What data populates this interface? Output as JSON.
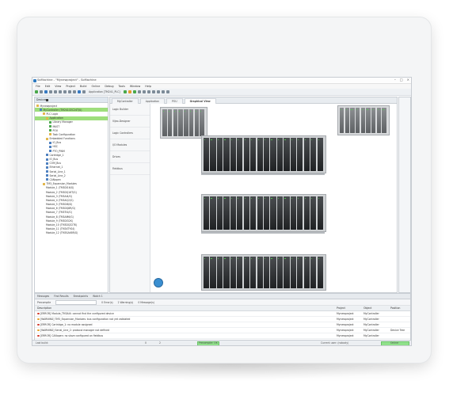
{
  "window": {
    "title": "SoMachine - \"Mynewproject\" - SoMachine"
  },
  "menu": [
    "File",
    "Edit",
    "View",
    "Project",
    "Build",
    "Online",
    "Debug",
    "Tools",
    "Window",
    "Help"
  ],
  "toolbar": {
    "application_selector": "Application [TM241_PLC]"
  },
  "left_panel": {
    "header": "Devices",
    "tree": [
      {
        "label": "Mynewproject",
        "icon": "folder",
        "indent": 0,
        "selected": false
      },
      {
        "label": "MyController (TM241CEC24T/U)",
        "icon": "dev",
        "indent": 1,
        "selected": true
      },
      {
        "label": "PLC Logic",
        "icon": "folder",
        "indent": 2,
        "selected": false
      },
      {
        "label": "Application",
        "icon": "folder",
        "indent": 3,
        "selected": true
      },
      {
        "label": "Library Manager",
        "icon": "green",
        "indent": 4,
        "selected": false
      },
      {
        "label": "MAST",
        "icon": "green",
        "indent": 4,
        "selected": false
      },
      {
        "label": "POU",
        "icon": "green",
        "indent": 4,
        "selected": false
      },
      {
        "label": "Task Configuration",
        "icon": "folder",
        "indent": 4,
        "selected": false
      },
      {
        "label": "Embedded Functions",
        "icon": "folder",
        "indent": 3,
        "selected": false
      },
      {
        "label": "IO_Bus",
        "icon": "dev",
        "indent": 4,
        "selected": false
      },
      {
        "label": "HSC",
        "icon": "dev",
        "indent": 4,
        "selected": false
      },
      {
        "label": "PTO_PWM",
        "icon": "dev",
        "indent": 4,
        "selected": false
      },
      {
        "label": "Cartridge_1",
        "icon": "dev",
        "indent": 3,
        "selected": false
      },
      {
        "label": "IO_Bus",
        "icon": "dev",
        "indent": 3,
        "selected": false
      },
      {
        "label": "COM_Bus",
        "icon": "dev",
        "indent": 3,
        "selected": false
      },
      {
        "label": "Ethernet_1",
        "icon": "dev",
        "indent": 3,
        "selected": false
      },
      {
        "label": "Serial_Line_1",
        "icon": "dev",
        "indent": 3,
        "selected": false
      },
      {
        "label": "Serial_Line_2",
        "icon": "dev",
        "indent": 3,
        "selected": false
      },
      {
        "label": "CANopen",
        "icon": "dev",
        "indent": 3,
        "selected": false
      },
      {
        "label": "TM3_Expansion_Modules",
        "icon": "folder",
        "indent": 2,
        "selected": false
      },
      {
        "label": "Module_1 (TM3DI16/G)",
        "icon": "mod",
        "indent": 3,
        "selected": false
      },
      {
        "label": "Module_2 (TM3DQ16T/G)",
        "icon": "mod",
        "indent": 3,
        "selected": false
      },
      {
        "label": "Module_3 (TM3AI4/G)",
        "icon": "mod",
        "indent": 3,
        "selected": false
      },
      {
        "label": "Module_4 (TM3AQ2/G)",
        "icon": "mod",
        "indent": 3,
        "selected": false
      },
      {
        "label": "Module_5 (TM3DI8/G)",
        "icon": "mod",
        "indent": 3,
        "selected": false
      },
      {
        "label": "Module_6 (TM3DQ8R/G)",
        "icon": "mod",
        "indent": 3,
        "selected": false
      },
      {
        "label": "Module_7 (TM3TI4/G)",
        "icon": "mod",
        "indent": 3,
        "selected": false
      },
      {
        "label": "Module_8 (TM3AM6/G)",
        "icon": "mod",
        "indent": 3,
        "selected": false
      },
      {
        "label": "Module_9 (TM3DI32K)",
        "icon": "mod",
        "indent": 3,
        "selected": false
      },
      {
        "label": "Module_10 (TM3DQ32TK)",
        "icon": "mod",
        "indent": 3,
        "selected": false
      },
      {
        "label": "Module_11 (TM3XTYS4)",
        "icon": "mod",
        "indent": 3,
        "selected": false
      },
      {
        "label": "Module_12 (TM3SAK6R/G)",
        "icon": "mod",
        "indent": 3,
        "selected": false
      }
    ]
  },
  "editor": {
    "tabs": [
      {
        "label": "MyController",
        "active": false
      },
      {
        "label": "Application",
        "active": false
      },
      {
        "label": "POU",
        "active": false
      },
      {
        "label": "Graphical View",
        "active": true
      }
    ],
    "catalog": [
      "Logic Builder",
      "Vijeo-Designer",
      "Logic Controllers",
      "I/O Modules",
      "Drives",
      "Fieldbus"
    ]
  },
  "bottom_panel": {
    "tabs": [
      "Messages",
      "Find Results",
      "Breakpoints",
      "Watch 1"
    ],
    "filter": {
      "label": "Precompile",
      "errors": "0 Error(s)",
      "warnings": "2 Warning(s)",
      "messages": "0 Message(s)"
    },
    "columns": [
      "Description",
      "Project",
      "Object",
      "Position"
    ],
    "rows": [
      {
        "level": "error",
        "description": "[ERROR] Module_TM3AI4: cannot find the configured device",
        "project": "Mynewproject",
        "object": "MyController",
        "position": ""
      },
      {
        "level": "warn",
        "description": "[WARNING] TM3_Expansion_Modules: bus configuration not yet validated",
        "project": "Mynewproject",
        "object": "MyController",
        "position": ""
      },
      {
        "level": "error",
        "description": "[ERROR] Cartridge_1: no module assigned",
        "project": "Mynewproject",
        "object": "MyController",
        "position": ""
      },
      {
        "level": "warn",
        "description": "[WARNING] Serial_Line_2: protocol manager not defined",
        "project": "Mynewproject",
        "object": "MyController",
        "position": "Device Tree"
      },
      {
        "level": "error",
        "description": "[ERROR] CANopen: no slave configured on fieldbus",
        "project": "Mynewproject",
        "object": "MyController",
        "position": ""
      }
    ]
  },
  "statusbar": {
    "last_build": "Last build:",
    "errors": "0",
    "warnings": "2",
    "precompile": "Precompile: OK",
    "current_user": "Current user: (nobody)",
    "status": "Online"
  },
  "colors": {
    "selection": "#9ede7c",
    "status_ok": "#8fe08a",
    "error": "#d23c2f",
    "warning": "#e5a22a"
  }
}
